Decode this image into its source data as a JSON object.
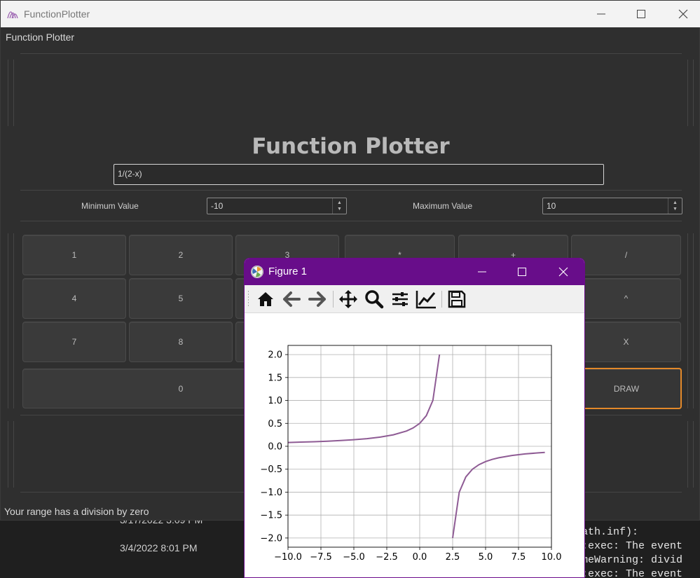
{
  "main_window": {
    "title": "FunctionPlotter",
    "menu_label": "Function Plotter",
    "app_title": "Function Plotter",
    "expression_value": "1/(2-x)",
    "min_label": "Minimum Value",
    "min_value": "-10",
    "max_label": "Maximum Value",
    "max_value": "10",
    "keys": [
      {
        "label": "1"
      },
      {
        "label": "2"
      },
      {
        "label": "3"
      },
      {
        "label": "*"
      },
      {
        "label": "+"
      },
      {
        "label": "/"
      },
      {
        "label": "4"
      },
      {
        "label": "5"
      },
      {
        "label": "^"
      },
      {
        "label": "7"
      },
      {
        "label": "8"
      },
      {
        "label": "X"
      },
      {
        "label": "0"
      },
      {
        "label": "DRAW"
      }
    ],
    "status_text": "Your range has a division by zero",
    "accent_color": "#e3892a"
  },
  "background": {
    "dates": [
      "3/17/2022 3:09 PM",
      "3/4/2022 8:01 PM"
    ],
    "terminal_lines": [
      "ath.inf):",
      ":exec: The event",
      "meWarning: divid",
      ":exec: The event"
    ]
  },
  "figure_window": {
    "title": "Figure 1",
    "title_bar_color": "#680d8a",
    "toolbar_icons": [
      "home-icon",
      "back-arrow-icon",
      "forward-arrow-icon",
      "pan-icon",
      "zoom-icon",
      "subplots-config-icon",
      "edit-axis-icon",
      "save-icon"
    ]
  },
  "chart_data": {
    "type": "line",
    "title": "",
    "xlabel": "",
    "ylabel": "",
    "xlim": [
      -10,
      10
    ],
    "ylim": [
      -2.2,
      2.2
    ],
    "grid": true,
    "x_ticks": [
      -10.0,
      -7.5,
      -5.0,
      -2.5,
      0.0,
      2.5,
      5.0,
      7.5,
      10.0
    ],
    "x_tick_labels": [
      "−10.0",
      "−7.5",
      "−5.0",
      "−2.5",
      "0.0",
      "2.5",
      "5.0",
      "7.5",
      "10.0"
    ],
    "y_ticks": [
      2.0,
      1.5,
      1.0,
      0.5,
      0.0,
      -0.5,
      -1.0,
      -1.5,
      -2.0
    ],
    "y_tick_labels": [
      "2.0",
      "1.5",
      "1.0",
      "0.5",
      "0.0",
      "−0.5",
      "−1.0",
      "−1.5",
      "−2.0"
    ],
    "series": [
      {
        "color": "#8e5b94",
        "segments": [
          [
            [
              -10,
              0.083
            ],
            [
              -9,
              0.091
            ],
            [
              -8,
              0.1
            ],
            [
              -7,
              0.111
            ],
            [
              -6,
              0.125
            ],
            [
              -5,
              0.143
            ],
            [
              -4,
              0.167
            ],
            [
              -3,
              0.2
            ],
            [
              -2,
              0.25
            ],
            [
              -1,
              0.333
            ],
            [
              -0.5,
              0.4
            ],
            [
              0,
              0.5
            ],
            [
              0.5,
              0.667
            ],
            [
              1,
              1.0
            ],
            [
              1.5,
              2.0
            ]
          ],
          [
            [
              2.5,
              -2.0
            ],
            [
              3,
              -1.0
            ],
            [
              3.5,
              -0.667
            ],
            [
              4,
              -0.5
            ],
            [
              4.5,
              -0.4
            ],
            [
              5,
              -0.333
            ],
            [
              5.5,
              -0.286
            ],
            [
              6,
              -0.25
            ],
            [
              7,
              -0.2
            ],
            [
              8,
              -0.167
            ],
            [
              9,
              -0.143
            ],
            [
              9.5,
              -0.133
            ]
          ]
        ]
      }
    ]
  }
}
